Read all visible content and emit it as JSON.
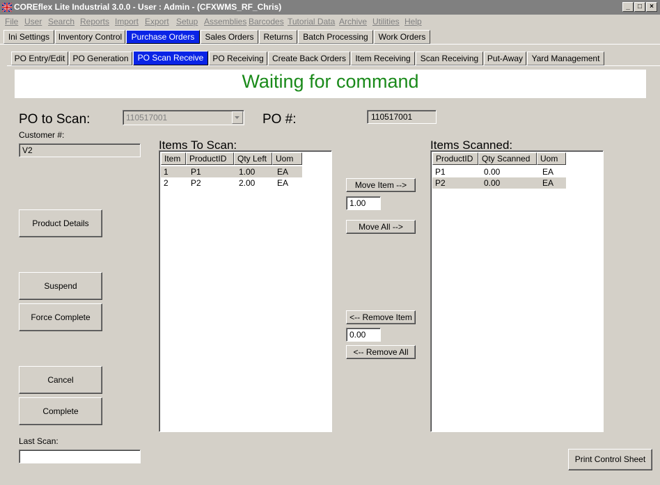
{
  "window": {
    "title": "COREflex Lite Industrial 3.0.0 - User : Admin - (CFXWMS_RF_Chris)"
  },
  "menu": [
    "File",
    "User",
    "Search",
    "Reports",
    "Import",
    "Export",
    "Setup",
    "Assemblies",
    "Barcodes",
    "Tutorial Data",
    "Archive",
    "Utilities",
    "Help"
  ],
  "main_tabs": [
    "Ini Settings",
    "Inventory Control",
    "Purchase Orders",
    "Sales Orders",
    "Returns",
    "Batch Processing",
    "Work Orders"
  ],
  "sub_tabs": [
    "PO Entry/Edit",
    "PO Generation",
    "PO Scan Receive",
    "PO Receiving",
    "Create Back Orders",
    "Item Receiving",
    "Scan Receiving",
    "Put-Away",
    "Yard Management"
  ],
  "status": {
    "text": "Waiting for command",
    "color": "#1a8a1a"
  },
  "form": {
    "po_to_scan_label": "PO to Scan:",
    "po_to_scan_value": "110517001",
    "po_num_label": "PO #:",
    "po_num_value": "110517001",
    "customer_label": "Customer #:",
    "customer_value": "V2",
    "last_scan_label": "Last Scan:",
    "last_scan_value": ""
  },
  "buttons": {
    "product_details": "Product Details",
    "suspend": "Suspend",
    "force_complete": "Force Complete",
    "cancel": "Cancel",
    "complete": "Complete",
    "move_item": "Move Item -->",
    "move_all": "Move All  -->",
    "remove_item": "<-- Remove Item",
    "remove_all": "<-- Remove All",
    "print_control_sheet": "Print Control Sheet"
  },
  "qty": {
    "move": "1.00",
    "remove": "0.00"
  },
  "items_to_scan": {
    "title": "Items To Scan:",
    "columns": [
      "Item",
      "ProductID",
      "Qty Left",
      "Uom"
    ],
    "rows": [
      [
        "1",
        "P1",
        "1.00",
        "EA"
      ],
      [
        "2",
        "P2",
        "2.00",
        "EA"
      ]
    ]
  },
  "items_scanned": {
    "title": "Items Scanned:",
    "columns": [
      "ProductID",
      "Qty Scanned",
      "Uom"
    ],
    "rows": [
      [
        "P1",
        "0.00",
        "EA"
      ],
      [
        "P2",
        "0.00",
        "EA"
      ]
    ]
  }
}
